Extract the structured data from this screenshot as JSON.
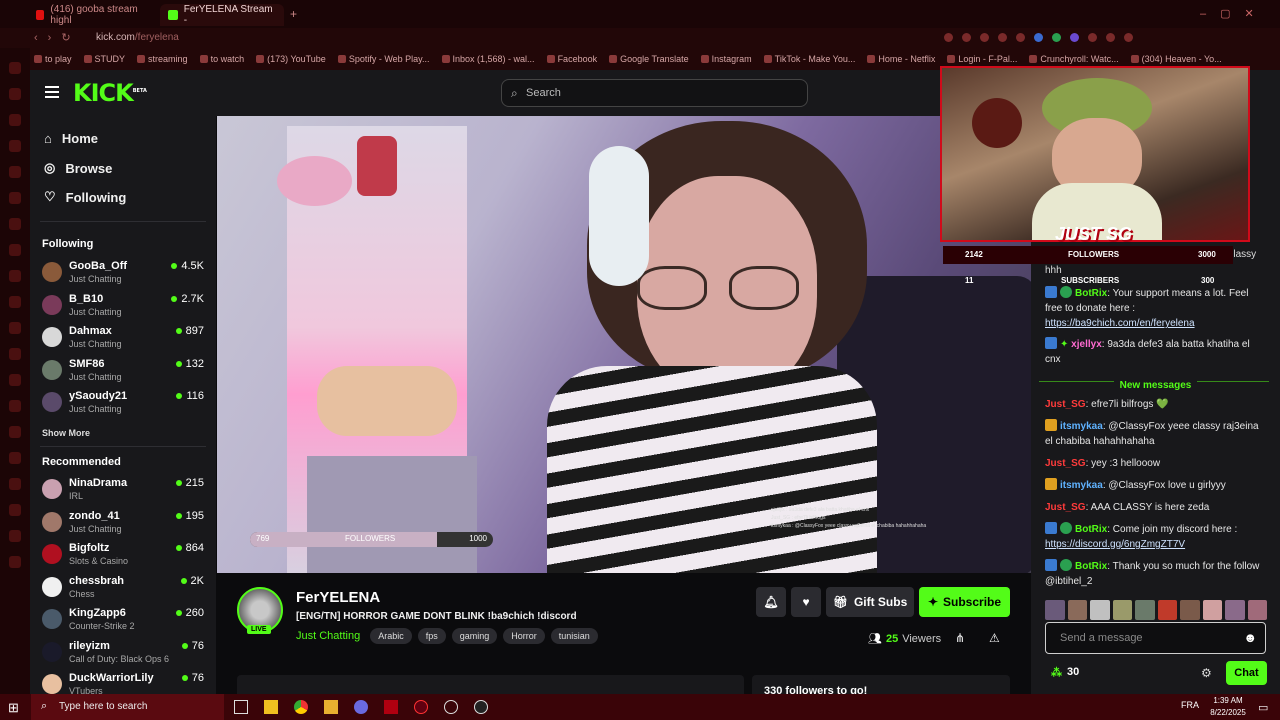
{
  "browser": {
    "tabs": [
      {
        "title": "(416) gooba stream highl",
        "active": false
      },
      {
        "title": "FerYELENA Stream - ",
        "active": true
      }
    ],
    "url_host": "kick.com",
    "url_path": "/feryelena",
    "bookmarks": [
      "to play",
      "STUDY",
      "streaming",
      "to watch",
      "(173) YouTube",
      "Spotify - Web Play...",
      "Inbox (1,568) - wal...",
      "Facebook",
      "Google Translate",
      "Instagram",
      "TikTok - Make You...",
      "Home - Netflix",
      "Login - F-Pal...",
      "Crunchyroll: Watc...",
      "(304) Heaven - Yo..."
    ]
  },
  "kick": {
    "logo": "KICK",
    "logo_sup": "BETA",
    "search_placeholder": "Search",
    "nav": [
      {
        "label": "Home",
        "icon": "home-icon"
      },
      {
        "label": "Browse",
        "icon": "compass-icon"
      },
      {
        "label": "Following",
        "icon": "heart-icon"
      }
    ],
    "following_title": "Following",
    "following": [
      {
        "name": "GooBa_Off",
        "category": "Just Chatting",
        "viewers": "4.5K",
        "color": "#8a5a3a"
      },
      {
        "name": "B_B10",
        "category": "Just Chatting",
        "viewers": "2.7K",
        "color": "#7a3a5a"
      },
      {
        "name": "Dahmax",
        "category": "Just Chatting",
        "viewers": "897",
        "color": "#d8d8d8"
      },
      {
        "name": "SMF86",
        "category": "Just Chatting",
        "viewers": "132",
        "color": "#6a7a6a"
      },
      {
        "name": "ySaoudy21",
        "category": "Just Chatting",
        "viewers": "116",
        "color": "#5a4a6a"
      }
    ],
    "show_more": "Show More",
    "recommended_title": "Recommended",
    "recommended": [
      {
        "name": "NinaDrama",
        "category": "IRL",
        "viewers": "215",
        "color": "#c9a0b0"
      },
      {
        "name": "zondo_41",
        "category": "Just Chatting",
        "viewers": "195",
        "color": "#a0786a"
      },
      {
        "name": "Bigfoltz",
        "category": "Slots & Casino",
        "viewers": "864",
        "color": "#b01020"
      },
      {
        "name": "chessbrah",
        "category": "Chess",
        "viewers": "2K",
        "color": "#f0f0f0"
      },
      {
        "name": "KingZapp6",
        "category": "Counter-Strike 2",
        "viewers": "260",
        "color": "#4a5a6a"
      },
      {
        "name": "rileyizm",
        "category": "Call of Duty: Black Ops 6",
        "viewers": "76",
        "color": "#1a1a2a"
      },
      {
        "name": "DuckWarriorLily",
        "category": "VTubers",
        "viewers": "76",
        "color": "#e8c0a0"
      }
    ]
  },
  "video": {
    "goal_left": "769",
    "goal_label": "FOLLOWERS",
    "goal_right": "1000",
    "goal_progress": 0.77,
    "overlay_chat": [
      "xjellyx : 9a3da defe3 ala batta khatiha el cnx",
      "Just_SG : efre7li bilfrogs",
      "itsmykaa : @ClassyFox yeee classy raj3eina el chabiba hahahhahaha"
    ]
  },
  "stream": {
    "streamer": "FerYELENA",
    "live_label": "LIVE",
    "title": "[ENG/TN] HORROR GAME DONT BLINK !ba9chich !discord",
    "category": "Just Chatting",
    "tags": [
      "Arabic",
      "fps",
      "gaming",
      "Horror",
      "tunisian"
    ],
    "gift_label": "Gift Subs",
    "subscribe_label": "Subscribe",
    "viewers": "25",
    "viewers_label": "Viewers",
    "below_text": "330 followers to go!"
  },
  "cam_overlay": {
    "name": "JUST SG",
    "followers_num": "2142",
    "followers_label": "FOLLOWERS",
    "followers_goal": "3000",
    "subs_num": "11",
    "subs_label": "SUBSCRIBERS",
    "subs_goal": "300"
  },
  "chat": {
    "partial_top": "dh3ef men... classy",
    "partial_hhh": "hhh",
    "messages": [
      {
        "user": "BotRix",
        "ucls": "u-green",
        "text": "Your support means a lot. Feel free to donate here :",
        "link": "https://ba9chich.com/en/feryelena"
      },
      {
        "user": "xjellyx",
        "ucls": "u-pink",
        "text": "9a3da defe3 ala batta khatiha el cnx"
      }
    ],
    "new_messages_label": "New messages",
    "new_messages": [
      {
        "user": "Just_SG",
        "ucls": "u-red",
        "text": "efre7li bilfrogs 💚"
      },
      {
        "user": "itsmykaa",
        "ucls": "u-blue",
        "text": "@ClassyFox yeee classy raj3eina el chabiba hahahhahaha"
      },
      {
        "user": "Just_SG",
        "ucls": "u-red",
        "text": "yey :3 hellooow"
      },
      {
        "user": "itsmykaa",
        "ucls": "u-blue",
        "text": "@ClassyFox love u girlyyy"
      },
      {
        "user": "Just_SG",
        "ucls": "u-red",
        "text": "AAA CLASSY is here zeda"
      },
      {
        "user": "BotRix",
        "ucls": "u-green",
        "text": "Come join my discord here :",
        "link": "https://discord.gg/6ngZmgZT7V"
      },
      {
        "user": "BotRix",
        "ucls": "u-green",
        "text": "Thank you so much for the follow @ibtihel_2"
      }
    ],
    "input_placeholder": "Send a message",
    "points": "30",
    "chat_button": "Chat"
  },
  "taskbar": {
    "search_placeholder": "Type here to search",
    "time": "1:39 AM",
    "date": "8/22/2025",
    "lang": "FRA"
  },
  "colors": {
    "kick_green": "#53fc18",
    "panel": "#18181b",
    "bg": "#0b0b0d",
    "chrome": "#220708"
  }
}
